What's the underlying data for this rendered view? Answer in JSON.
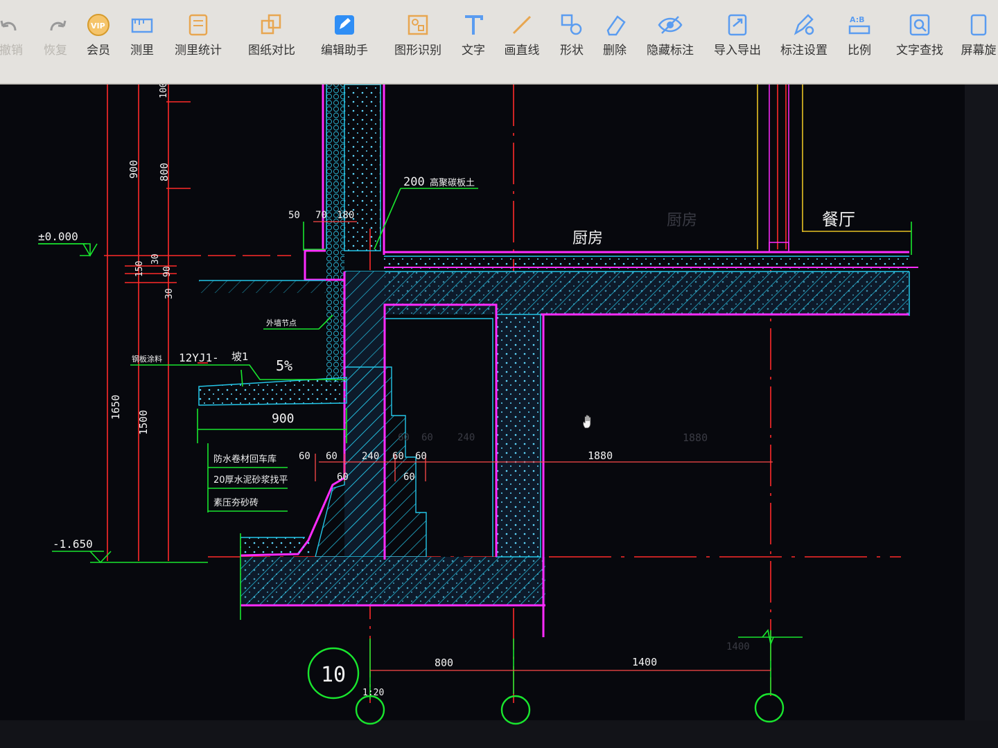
{
  "toolbar": {
    "tools": [
      {
        "label": "撤销",
        "icon": "undo-icon"
      },
      {
        "label": "恢复",
        "icon": "redo-icon"
      },
      {
        "label": "会员",
        "icon": "vip-icon"
      },
      {
        "label": "测里",
        "icon": "measure-icon"
      },
      {
        "label": "测里统计",
        "icon": "measure-stats-icon"
      },
      {
        "label": "图纸对比",
        "icon": "compare-icon"
      },
      {
        "label": "编辑助手",
        "icon": "edit-assistant-icon"
      },
      {
        "label": "图形识别",
        "icon": "shape-recognition-icon"
      },
      {
        "label": "文字",
        "icon": "text-icon"
      },
      {
        "label": "画直线",
        "icon": "line-icon"
      },
      {
        "label": "形状",
        "icon": "shape-icon"
      },
      {
        "label": "删除",
        "icon": "eraser-icon"
      },
      {
        "label": "隐藏标注",
        "icon": "eye-icon"
      },
      {
        "label": "导入导出",
        "icon": "import-export-icon"
      },
      {
        "label": "标注设置",
        "icon": "annotation-settings-icon"
      },
      {
        "label": "比例",
        "icon": "scale-icon"
      },
      {
        "label": "文字查找",
        "icon": "text-search-icon"
      },
      {
        "label": "屏幕旋",
        "icon": "rotate-screen-icon"
      }
    ]
  },
  "drawing": {
    "rooms": {
      "kitchen": "厨房",
      "kitchen_faint": "厨房",
      "dining": "餐厅"
    },
    "levels": {
      "top": "±0.000",
      "bottom": "-1.650"
    },
    "left_dims": {
      "d900": "900",
      "d800": "800",
      "d100": "100",
      "d150": "150",
      "d30a": "30",
      "d90": "90",
      "d30b": "30",
      "d1650": "1650",
      "d1500": "1500"
    },
    "top_dims": {
      "d50": "50",
      "d70": "70",
      "d180": "180"
    },
    "callouts": {
      "wall": "200",
      "wall_note": "高聚碳板土",
      "stair": "外墙节点",
      "slope_note": "钢板涂料",
      "slope_ref": "12YJ1-",
      "slope_no": "坡1",
      "slope": "5%",
      "width": "900"
    },
    "legend": [
      "防水卷材回车库",
      "20厚水泥砂浆找平",
      "素压夯砂砖"
    ],
    "mid_dims": {
      "a": "60",
      "b": "60",
      "c": "240",
      "d": "60",
      "e": "60",
      "f": "1880",
      "g": "60",
      "h": "60"
    },
    "faint_dims": {
      "a": "60",
      "b": "60",
      "c": "240",
      "d": "1880"
    },
    "bottom_dims": {
      "d800": "800",
      "d1400": "1400",
      "faint": "1400",
      "scale": "1:20"
    },
    "section_no": "10"
  },
  "colors": {
    "wall_cyan": "#24c6e8",
    "accent_magenta": "#ff2bff",
    "axis_red": "#ff2a2a",
    "dim_green": "#19e62e",
    "text_white": "#f2f2f2"
  }
}
